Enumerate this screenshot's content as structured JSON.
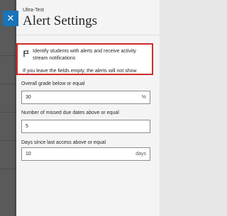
{
  "panel": {
    "course_name": "Ultra-Test",
    "title": "Alert Settings"
  },
  "notice": {
    "text": "Identify students with alerts and receive activity stream notifications",
    "empty_note": "If you leave the fields empty, the alerts will not show"
  },
  "fields": [
    {
      "label": "Overall grade below or equal",
      "value": "30",
      "unit": "%"
    },
    {
      "label": "Number of missed due dates above or equal",
      "value": "5",
      "unit": ""
    },
    {
      "label": "Days since last access above or equal",
      "value": "10",
      "unit": "days"
    }
  ],
  "colors": {
    "accent": "#1873b8",
    "highlight_border": "#cf2a2a"
  },
  "icons": {
    "close": "close-icon",
    "notice": "flag-icon"
  }
}
